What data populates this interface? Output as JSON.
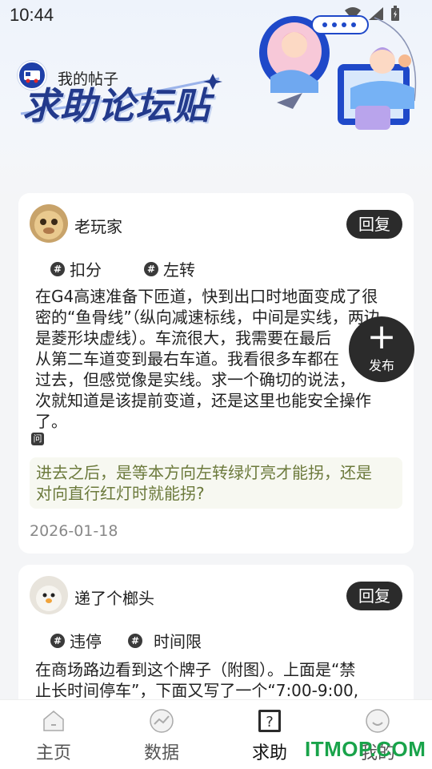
{
  "status_bar": {
    "time": "10:44"
  },
  "header": {
    "my_posts_label": "我的帖子",
    "brand_title": "求助论坛贴"
  },
  "posts": [
    {
      "author": "老玩家",
      "reply_label": "回复",
      "tags": [
        "扣分",
        "左转"
      ],
      "content": "在G4高速准备下匝道，快到出口时地面变成了很密的“鱼骨线”（纵向减速标线，中间是实线，两边是菱形块虚线）。车流很大，我需要在最后……从第二车道变到最右车道。我看很多车都在……过去，但感觉像是实线。求一个确切的说法，……次就知道是该提前变道，还是这里也能安全操作了。",
      "content_lines": [
        "在G4高速准备下匝道，快到出口时地面变成了很",
        "密的“鱼骨线”（纵向减速标线，中间是实线，两边",
        "是菱形块虚线）。车流很大，我需要在最后",
        "从第二车道变到最右车道。我看很多车都在",
        "过去，但感觉像是实线。求一个确切的说法，",
        "次就知道是该提前变道，还是这里也能安全操作",
        "了。"
      ],
      "question_icon": "问",
      "question": "进去之后，是等本方向左转绿灯亮才能拐，还是对向直行红灯时就能拐?",
      "question_lines": [
        "进去之后，是等本方向左转绿灯亮才能拐，还是",
        "对向直行红灯时就能拐?"
      ],
      "date": "2026-01-18"
    },
    {
      "author": "递了个榔头",
      "reply_label": "回复",
      "tags": [
        "违停",
        "时间限"
      ],
      "content_lines": [
        "在商场路边看到这个牌子（附图）。上面是“禁",
        "止长时间停车”，下面又写了一个“7:00-9:00,"
      ]
    }
  ],
  "fab": {
    "plus": "+",
    "label": "发布"
  },
  "tabs": [
    {
      "label": "主页",
      "icon": "home-icon"
    },
    {
      "label": "数据",
      "icon": "chart-icon"
    },
    {
      "label": "求助",
      "icon": "question-icon",
      "active": true
    },
    {
      "label": "我的",
      "icon": "profile-icon"
    }
  ],
  "watermark": "ITMOP.COM",
  "colors": {
    "accent_dark": "#2b2b2b",
    "brand_blue": "#233a8c",
    "question_text": "#6c7a3c",
    "watermark": "#19a34a"
  }
}
